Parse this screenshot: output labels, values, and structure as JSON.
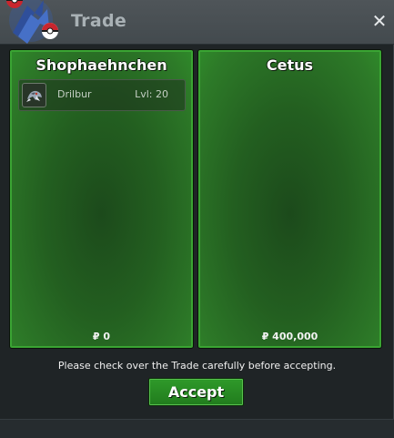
{
  "window": {
    "title": "Trade",
    "close_symbol": "✕"
  },
  "panels": [
    {
      "owner": "Shophaehnchen",
      "items": [
        {
          "name": "Drilbur",
          "level": "Lvl: 20",
          "icon": "drilbur-pokemon-icon"
        }
      ],
      "money": "₽ 0"
    },
    {
      "owner": "Cetus",
      "items": [],
      "money": "₽ 400,000"
    }
  ],
  "footer": {
    "note": "Please check over the Trade carefully before accepting.",
    "accept_label": "Accept"
  },
  "colors": {
    "panel_green": "#2d7a28",
    "accept_green": "#2f9a2a",
    "title_text": "#a9b1b5"
  }
}
